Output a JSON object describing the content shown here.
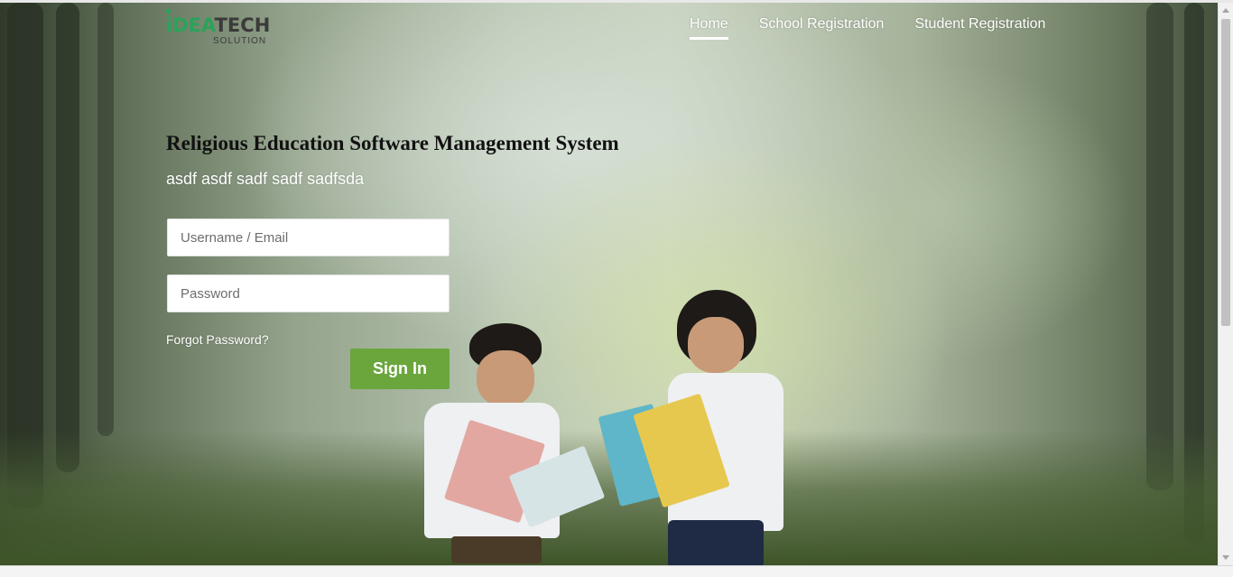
{
  "brand": {
    "logo_main_left": "iDEA",
    "logo_main_right": "TECH",
    "logo_sub": "SOLUTION",
    "accent_color": "#2aa35a"
  },
  "nav": {
    "items": [
      {
        "label": "Home",
        "active": true
      },
      {
        "label": "School Registration",
        "active": false
      },
      {
        "label": "Student Registration",
        "active": false
      }
    ]
  },
  "hero": {
    "title": "Religious Education Software Management System",
    "subtitle": "asdf asdf sadf sadf sadfsda"
  },
  "login": {
    "username_placeholder": "Username / Email",
    "username_value": "",
    "password_placeholder": "Password",
    "password_value": "",
    "forgot_label": "Forgot Password?",
    "signin_label": "Sign In",
    "signin_color": "#6aa63c"
  }
}
